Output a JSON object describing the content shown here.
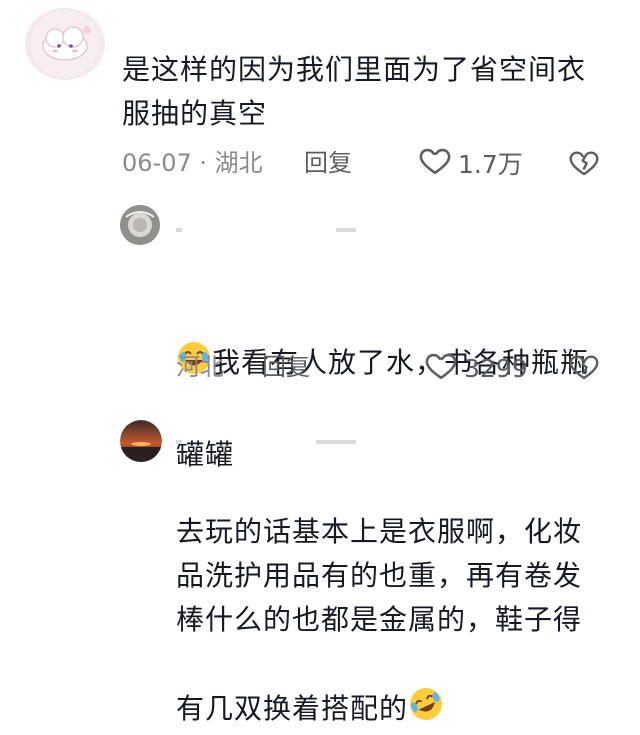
{
  "comments": [
    {
      "text": "是这样的因为我们里面为了省空间衣\n服抽的真空",
      "date": "06-07",
      "location": "湖北",
      "reply_label": "回复",
      "likes": "1.7万"
    },
    {
      "text_line1": "我看有人放了水，书各种瓶瓶",
      "text_line2": "罐罐",
      "location": "河北",
      "reply_label": "回复",
      "likes": "3299"
    },
    {
      "text": "去玩的话基本上是衣服啊，化妆\n品洗护用品有的也重，再有卷发\n棒什么的也都是金属的，鞋子得\n有几双换着搭配的"
    }
  ],
  "icons": [
    "heart-outline-icon",
    "broken-heart-icon",
    "laughing-tears-emoji",
    "rofl-emoji"
  ]
}
